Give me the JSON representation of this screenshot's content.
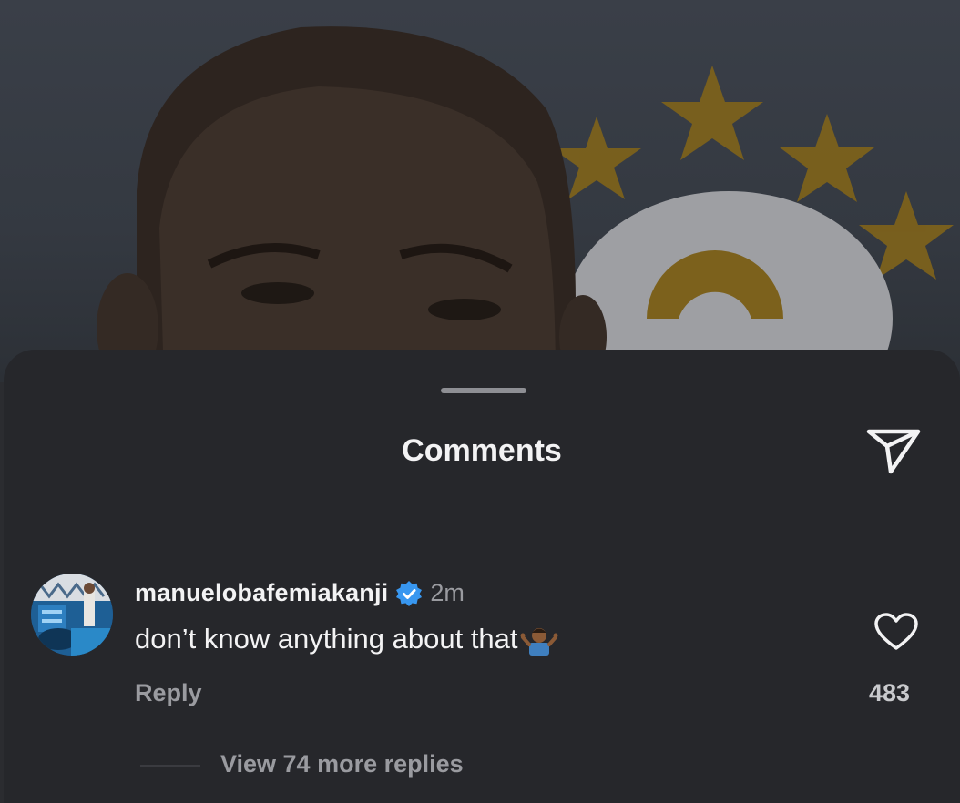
{
  "sheet": {
    "title": "Comments"
  },
  "comment": {
    "username": "manuelobafemiakanji",
    "verified": true,
    "time": "2m",
    "text": "don’t know anything about that",
    "emoji": "person-shrugging-emoji",
    "reply_label": "Reply",
    "like_count": "483"
  },
  "replies": {
    "view_more_label": "View 74 more replies"
  },
  "colors": {
    "sheet_bg": "#26272b",
    "text_primary": "#f3f3f4",
    "text_secondary": "#9a9ba0",
    "verified_blue": "#3897f0",
    "star_gold": "#8a6a1c"
  },
  "icons": [
    "share-send-icon",
    "verified-badge-icon",
    "heart-icon"
  ]
}
